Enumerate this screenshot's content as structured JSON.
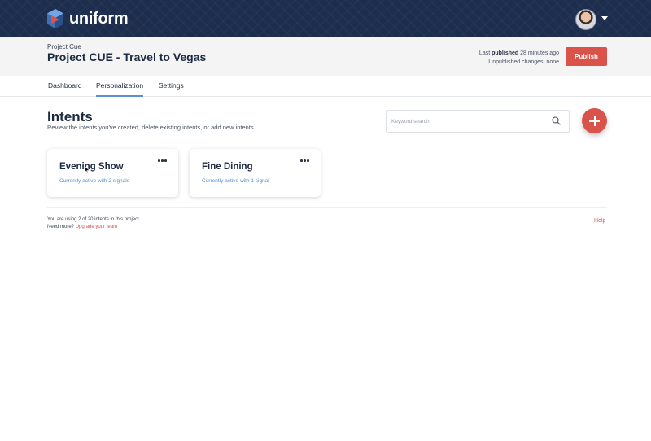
{
  "app": {
    "name": "uniform"
  },
  "colors": {
    "topbar": "#1d2d4d",
    "accent": "#d9534a",
    "link_blue": "#4e8fd0"
  },
  "header": {
    "project_label": "Project Cue",
    "project_title": "Project CUE - Travel to Vegas",
    "last_published_prefix": "Last",
    "last_published_bold": "published",
    "last_published_suffix": "28 minutes ago",
    "unpublished_changes": "Unpublished changes: none",
    "publish_label": "Publish"
  },
  "tabs": [
    {
      "label": "Dashboard",
      "active": false
    },
    {
      "label": "Personalization",
      "active": true
    },
    {
      "label": "Settings",
      "active": false
    }
  ],
  "intents": {
    "title": "Intents",
    "description": "Review the intents you've created, delete existing intents, or add new intents.",
    "search_placeholder": "Keyword search",
    "add_icon": "plus-icon",
    "cards": [
      {
        "title": "Evening Show",
        "status": "Currently active with 2 signals"
      },
      {
        "title": "Fine Dining",
        "status": "Currently active with 1 signal"
      }
    ]
  },
  "footer": {
    "usage": "You are using 2 of 20 intents in this project.",
    "need_more": "Need more?",
    "upgrade_link": "Upgrade your team",
    "help": "Help"
  }
}
